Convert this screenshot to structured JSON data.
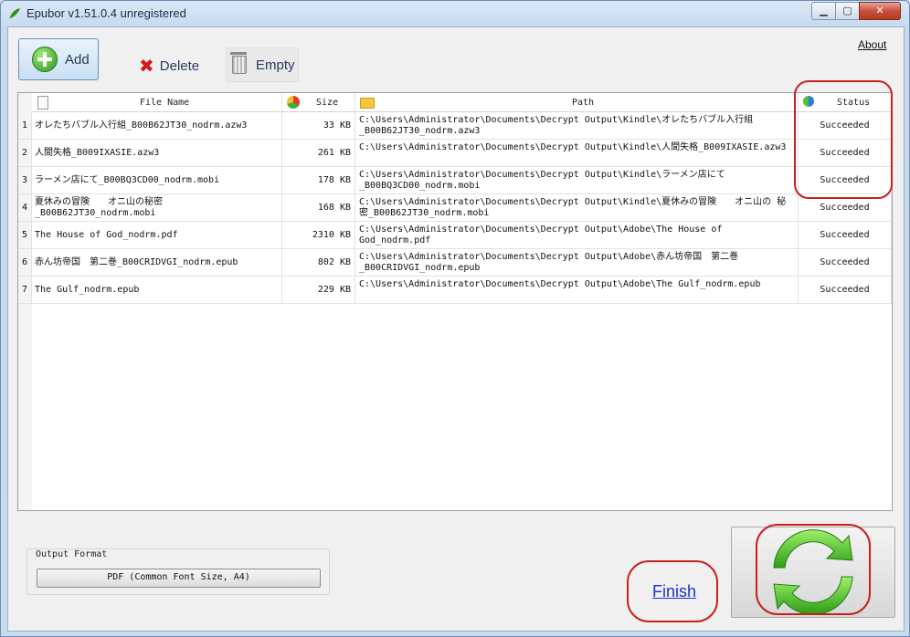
{
  "window": {
    "title": "Epubor v1.51.0.4    unregistered",
    "min_label": "▁",
    "max_label": "▢",
    "close_label": "✕"
  },
  "toolbar": {
    "add_label": "Add",
    "delete_label": "Delete",
    "empty_label": "Empty",
    "about_label": "About"
  },
  "table": {
    "headers": {
      "name": "File Name",
      "size": "Size",
      "path": "Path",
      "status": "Status"
    },
    "rows": [
      {
        "num": "1",
        "name": "オレたちバブル入行組_B00B62JT30_nodrm.azw3",
        "size": "33 KB",
        "path": "C:\\Users\\Administrator\\Documents\\Decrypt Output\\Kindle\\オレたちバブル入行組 _B00B62JT30_nodrm.azw3",
        "status": "Succeeded"
      },
      {
        "num": "2",
        "name": "人間失格_B009IXASIE.azw3",
        "size": "261 KB",
        "path": "C:\\Users\\Administrator\\Documents\\Decrypt Output\\Kindle\\人間失格_B009IXASIE.azw3",
        "status": "Succeeded"
      },
      {
        "num": "3",
        "name": "ラーメン店にて_B00BQ3CD00_nodrm.mobi",
        "size": "178 KB",
        "path": "C:\\Users\\Administrator\\Documents\\Decrypt Output\\Kindle\\ラーメン店にて _B00BQ3CD00_nodrm.mobi",
        "status": "Succeeded"
      },
      {
        "num": "4",
        "name": "夏休みの冒険　　オニ山の秘密 _B00B62JT30_nodrm.mobi",
        "size": "168 KB",
        "path": "C:\\Users\\Administrator\\Documents\\Decrypt Output\\Kindle\\夏休みの冒険　　オニ山の 秘密_B00B62JT30_nodrm.mobi",
        "status": "Succeeded"
      },
      {
        "num": "5",
        "name": "The House of God_nodrm.pdf",
        "size": "2310 KB",
        "path": "C:\\Users\\Administrator\\Documents\\Decrypt Output\\Adobe\\The House of God_nodrm.pdf",
        "status": "Succeeded"
      },
      {
        "num": "6",
        "name": "赤ん坊帝国　第二巻_B00CRIDVGI_nodrm.epub",
        "size": "802 KB",
        "path": "C:\\Users\\Administrator\\Documents\\Decrypt Output\\Adobe\\赤ん坊帝国　第二巻 _B00CRIDVGI_nodrm.epub",
        "status": "Succeeded"
      },
      {
        "num": "7",
        "name": "The Gulf_nodrm.epub",
        "size": "229 KB",
        "path": "C:\\Users\\Administrator\\Documents\\Decrypt Output\\Adobe\\The Gulf_nodrm.epub",
        "status": "Succeeded"
      }
    ]
  },
  "output": {
    "label": "Output Format",
    "value": "PDF (Common Font Size, A4)"
  },
  "finish_label": "Finish",
  "icons": {
    "add": "add-circle-icon",
    "delete": "red-x-icon",
    "empty": "trash-icon",
    "convert": "green-refresh-icon"
  },
  "colors": {
    "highlight": "#c8201e",
    "convert_green": "#3fb41f",
    "link_blue": "#1e2fd0"
  }
}
